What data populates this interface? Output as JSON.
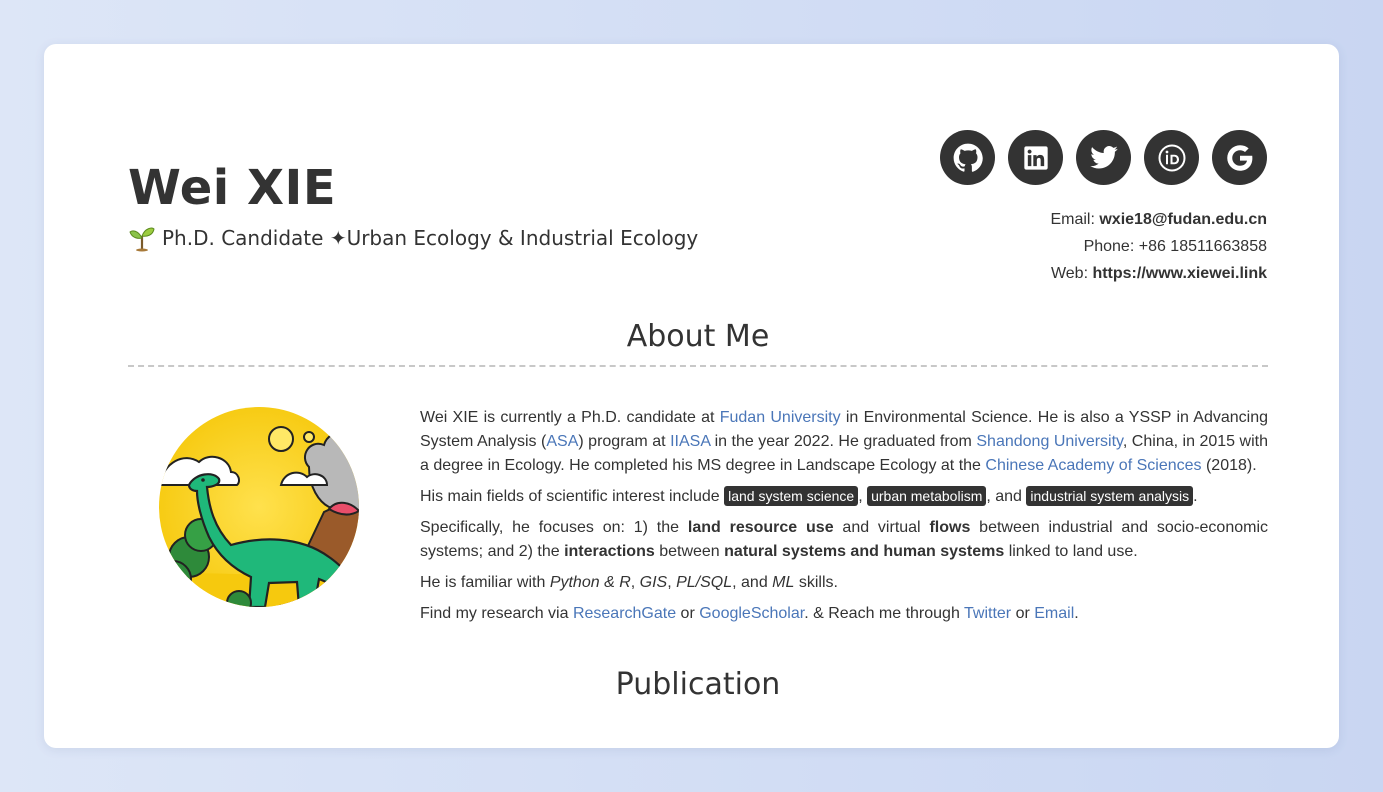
{
  "profile": {
    "name": "Wei XIE",
    "subtitle": "Ph.D. Candidate ✦Urban Ecology & Industrial Ecology"
  },
  "social": [
    {
      "name": "github-icon"
    },
    {
      "name": "linkedin-icon"
    },
    {
      "name": "twitter-icon"
    },
    {
      "name": "orcid-icon"
    },
    {
      "name": "google-icon"
    }
  ],
  "contact": {
    "email_label": "Email: ",
    "email": "wxie18@fudan.edu.cn",
    "phone_label": "Phone: ",
    "phone": "+86 18511663858",
    "web_label": "Web: ",
    "web": "https://www.xiewei.link"
  },
  "about": {
    "title": "About Me",
    "p1": {
      "t1": "Wei XIE is currently a Ph.D. candidate at ",
      "l1": "Fudan University",
      "t2": " in Environmental Science. He is also a YSSP in Advancing System Analysis (",
      "l2": "ASA",
      "t3": ") program at ",
      "l3": "IIASA",
      "t4": " in the year 2022. He graduated from ",
      "l4": "Shandong University",
      "t5": ", China, in 2015 with a degree in Ecology. He completed his MS degree in Landscape Ecology at the ",
      "l5": "Chinese Academy of Sciences",
      "t6": " (2018)."
    },
    "p2": {
      "t1": "His main fields of scientific interest include ",
      "tag1": "land system science",
      "t2": ", ",
      "tag2": "urban metabolism",
      "t3": ", and ",
      "tag3": "industrial system analysis",
      "t4": "."
    },
    "p3": {
      "t1": "Specifically, he focuses on: 1) the ",
      "b1": "land resource use",
      "t2": " and virtual ",
      "b2": "flows",
      "t3": " between industrial and socio-economic systems; and 2) the ",
      "b3": "interactions",
      "t4": " between ",
      "b4": "natural systems and human systems",
      "t5": " linked to land use."
    },
    "p4": {
      "t1": "He is familiar with ",
      "i1": "Python & R",
      "t2": ", ",
      "i2": "GIS",
      "t3": ", ",
      "i3": "PL/SQL",
      "t4": ", and ",
      "i4": "ML",
      "t5": " skills."
    },
    "p5": {
      "t1": "Find my research via ",
      "l1": "ResearchGate",
      "t2": " or ",
      "l2": "GoogleScholar",
      "t3": ". & Reach me through ",
      "l3": "Twitter",
      "t4": " or ",
      "l4": "Email",
      "t5": "."
    }
  },
  "publication": {
    "title": "Publication"
  },
  "colors": {
    "link": "#4a76b8",
    "dark": "#333333",
    "background": "#d5e0f5"
  }
}
